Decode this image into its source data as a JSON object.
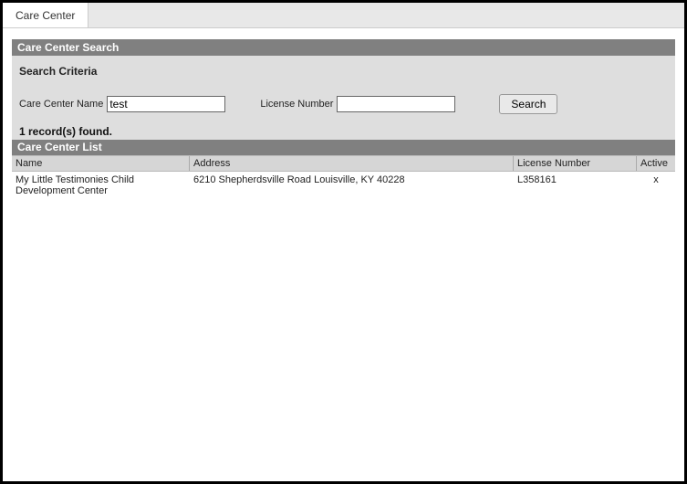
{
  "tab": {
    "label": "Care Center"
  },
  "search": {
    "section_header": "Care Center Search",
    "criteria_title": "Search Criteria",
    "care_center_name_label": "Care Center Name",
    "care_center_name_value": "test",
    "license_number_label": "License Number",
    "license_number_value": "",
    "button_label": "Search",
    "records_found": "1 record(s) found."
  },
  "list": {
    "header": "Care Center List",
    "columns": {
      "name": "Name",
      "address": "Address",
      "license": "License Number",
      "active": "Active"
    },
    "rows": [
      {
        "name": "My Little Testimonies Child Development Center",
        "address": "6210 Shepherdsville Road Louisville, KY 40228",
        "license": "L358161",
        "active": "x"
      }
    ]
  }
}
